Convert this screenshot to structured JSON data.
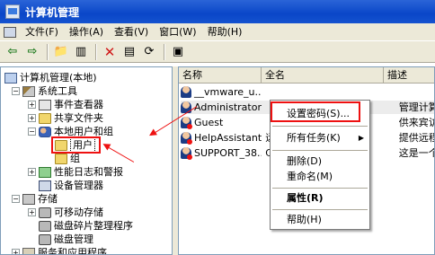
{
  "window": {
    "title": "计算机管理"
  },
  "menubar": {
    "items": [
      "文件(F)",
      "操作(A)",
      "查看(V)",
      "窗口(W)",
      "帮助(H)"
    ]
  },
  "toolbar": {
    "buttons": [
      "back-arrow-icon",
      "forward-arrow-icon",
      "up-folder-icon",
      "show-tree-icon",
      "delete-x-icon",
      "properties-icon",
      "refresh-icon",
      "help-icon"
    ]
  },
  "tree": {
    "root": "计算机管理(本地)",
    "system_tools": "系统工具",
    "event_viewer": "事件查看器",
    "shared_folders": "共享文件夹",
    "local_users": "本地用户和组",
    "users": "用户",
    "groups": "组",
    "perf_logs": "性能日志和警报",
    "device_manager": "设备管理器",
    "storage": "存储",
    "removable": "可移动存储",
    "defrag": "磁盘碎片整理程序",
    "disk_mgmt": "磁盘管理",
    "services": "服务和应用程序"
  },
  "listview": {
    "columns": [
      "名称",
      "全名",
      "描述"
    ],
    "rows": [
      {
        "name": "__vmware_u...",
        "full": "",
        "desc": ""
      },
      {
        "name": "Administrator",
        "full": "",
        "desc": "管理计算"
      },
      {
        "name": "Guest",
        "full": "",
        "desc": "供来宾访"
      },
      {
        "name": "HelpAssistant",
        "full": "远",
        "desc": "提供远程"
      },
      {
        "name": "SUPPORT_38...",
        "full": "C",
        "desc": "这是一个"
      }
    ]
  },
  "context_menu": {
    "set_password": "设置密码(S)...",
    "all_tasks": "所有任务(K)",
    "delete": "删除(D)",
    "rename": "重命名(M)",
    "properties": "属性(R)",
    "help": "帮助(H)"
  },
  "colors": {
    "annotation": "#e11111",
    "title_bar": "#0a46c8"
  }
}
